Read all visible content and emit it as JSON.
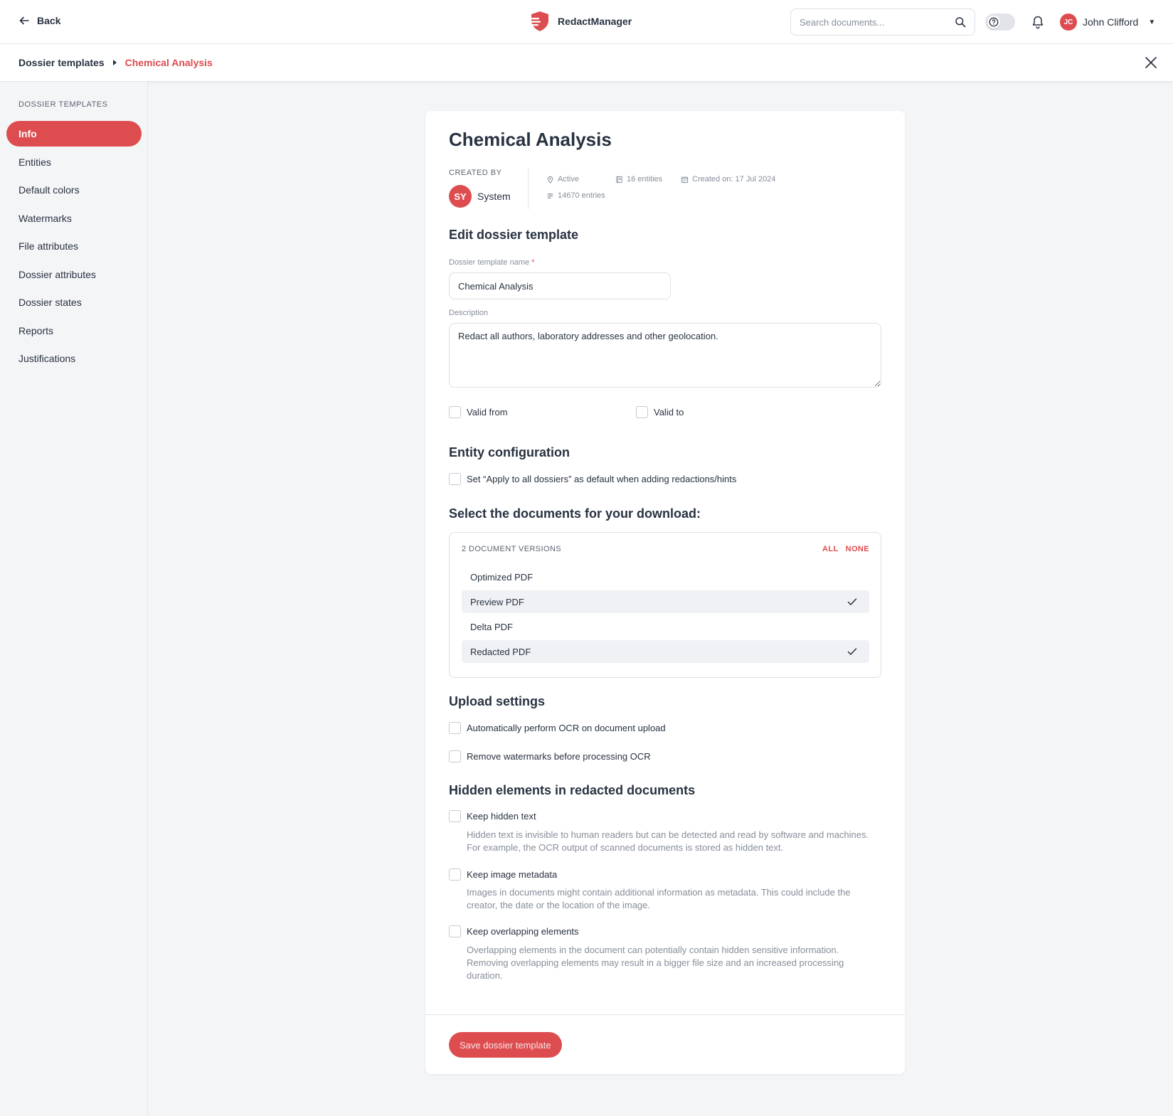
{
  "header": {
    "back_label": "Back",
    "brand_name": "RedactManager",
    "search_placeholder": "Search documents...",
    "user_initials": "JC",
    "user_name": "John Clifford"
  },
  "breadcrumb": {
    "parent": "Dossier templates",
    "current": "Chemical Analysis"
  },
  "sidebar": {
    "title": "DOSSIER TEMPLATES",
    "items": [
      {
        "label": "Info",
        "active": true
      },
      {
        "label": "Entities"
      },
      {
        "label": "Default colors"
      },
      {
        "label": "Watermarks"
      },
      {
        "label": "File attributes"
      },
      {
        "label": "Dossier attributes"
      },
      {
        "label": "Dossier states"
      },
      {
        "label": "Reports"
      },
      {
        "label": "Justifications"
      }
    ]
  },
  "info": {
    "title": "Chemical Analysis",
    "created_by_label": "CREATED BY",
    "creator_initials": "SY",
    "creator_name": "System",
    "status": "Active",
    "entities": "16 entities",
    "created_on": "Created on: 17 Jul 2024",
    "entries": "14670 entries"
  },
  "edit": {
    "section_title": "Edit dossier template",
    "name_label": "Dossier template name",
    "name_required": "*",
    "name_value": "Chemical Analysis",
    "description_label": "Description",
    "description_value": "Redact all authors, laboratory addresses and other geolocation.",
    "valid_from_label": "Valid from",
    "valid_to_label": "Valid to"
  },
  "entity_config": {
    "section_title": "Entity configuration",
    "apply_all_label": "Set “Apply to all dossiers” as default when adding redactions/hints"
  },
  "download": {
    "section_title": "Select the documents for your download:",
    "count_label": "2 DOCUMENT VERSIONS",
    "all_label": "ALL",
    "none_label": "NONE",
    "items": [
      {
        "label": "Optimized PDF",
        "selected": false
      },
      {
        "label": "Preview PDF",
        "selected": true
      },
      {
        "label": "Delta PDF",
        "selected": false
      },
      {
        "label": "Redacted PDF",
        "selected": true
      }
    ]
  },
  "upload": {
    "section_title": "Upload settings",
    "ocr_label": "Automatically perform OCR on document upload",
    "watermark_label": "Remove watermarks before processing OCR"
  },
  "hidden": {
    "section_title": "Hidden elements in redacted documents",
    "hidden_text_label": "Keep hidden text",
    "hidden_text_help": "Hidden text is invisible to human readers but can be detected and read by software and machines. For example, the OCR output of scanned documents is stored as hidden text.",
    "image_meta_label": "Keep image metadata",
    "image_meta_help": "Images in documents might contain additional information as metadata. This could include the creator, the date or the location of the image.",
    "overlap_label": "Keep overlapping elements",
    "overlap_help": "Overlapping elements in the document can potentially contain hidden sensitive information. Removing overlapping elements may result in a bigger file size and an increased processing duration."
  },
  "actions": {
    "save_label": "Save dossier template"
  },
  "colors": {
    "accent": "#dd4d50",
    "text": "#283241",
    "muted": "#868e9a",
    "background": "#f4f5f7"
  }
}
